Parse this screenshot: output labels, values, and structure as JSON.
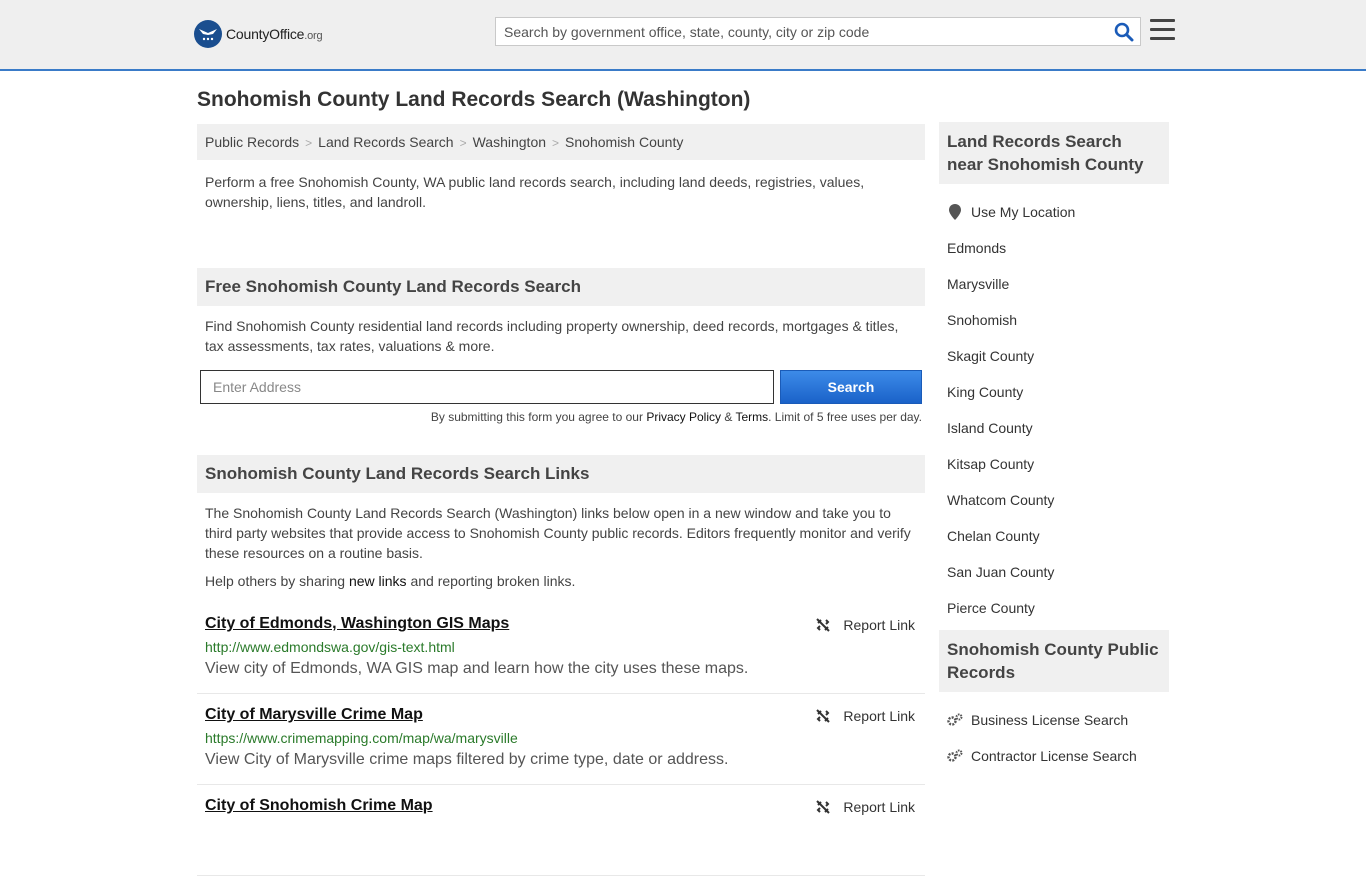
{
  "header": {
    "logo_main": "CountyOffice",
    "logo_suffix": ".org",
    "search_placeholder": "Search by government office, state, county, city or zip code"
  },
  "page_title": "Snohomish County Land Records Search (Washington)",
  "breadcrumb": [
    "Public Records",
    "Land Records Search",
    "Washington",
    "Snohomish County"
  ],
  "intro": "Perform a free Snohomish County, WA public land records search, including land deeds, registries, values, ownership, liens, titles, and landroll.",
  "free_search": {
    "heading": "Free Snohomish County Land Records Search",
    "text": "Find Snohomish County residential land records including property ownership, deed records, mortgages & titles, tax assessments, tax rates, valuations & more.",
    "address_placeholder": "Enter Address",
    "button_label": "Search",
    "disclaimer_pre": "By submitting this form you agree to our ",
    "privacy_label": "Privacy Policy",
    "amp": " & ",
    "terms_label": "Terms",
    "disclaimer_post": ". Limit of 5 free uses per day."
  },
  "links_section": {
    "heading": "Snohomish County Land Records Search Links",
    "text": "The Snohomish County Land Records Search (Washington) links below open in a new window and take you to third party websites that provide access to Snohomish County public records. Editors frequently monitor and verify these resources on a routine basis.",
    "share_pre": "Help others by sharing ",
    "share_link": "new links",
    "share_post": " and reporting broken links.",
    "report_label": "Report Link",
    "items": [
      {
        "title": "City of Edmonds, Washington GIS Maps",
        "url": "http://www.edmondswa.gov/gis-text.html",
        "desc": "View city of Edmonds, WA GIS map and learn how the city uses these maps."
      },
      {
        "title": "City of Marysville Crime Map",
        "url": "https://www.crimemapping.com/map/wa/marysville",
        "desc": "View City of Marysville crime maps filtered by crime type, date or address."
      },
      {
        "title": "City of Snohomish Crime Map",
        "url": "",
        "desc": ""
      }
    ]
  },
  "sidebar": {
    "nearby_heading": "Land Records Search near Snohomish County",
    "use_location": "Use My Location",
    "nearby": [
      "Edmonds",
      "Marysville",
      "Snohomish",
      "Skagit County",
      "King County",
      "Island County",
      "Kitsap County",
      "Whatcom County",
      "Chelan County",
      "San Juan County",
      "Pierce County"
    ],
    "public_heading": "Snohomish County Public Records",
    "public_links": [
      "Business License Search",
      "Contractor License Search"
    ]
  }
}
